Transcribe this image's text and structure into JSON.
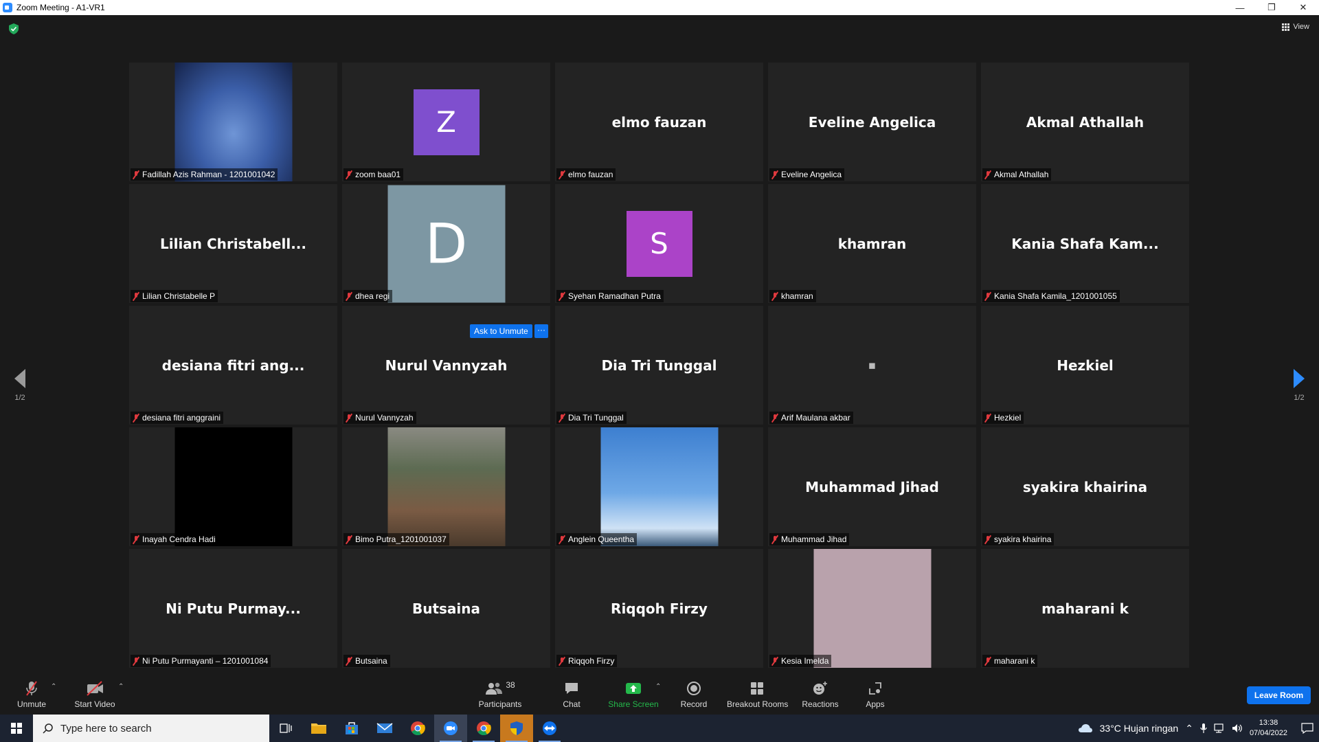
{
  "window": {
    "title": "Zoom Meeting - A1-VR1",
    "minimize": "—",
    "restore": "❐",
    "close": "✕"
  },
  "meeting": {
    "view_label": "View",
    "ask_to_unmute": "Ask to Unmute",
    "more": "···",
    "pager_left": "1/2",
    "pager_right": "1/2"
  },
  "tiles": [
    {
      "display": "",
      "label": "Fadillah Azis Rahman - 1201001042",
      "kind": "video",
      "bg": "#3b5ea8"
    },
    {
      "display": "Z",
      "label": "zoom baa01",
      "kind": "avatar",
      "color": "#7f4fce"
    },
    {
      "display": "elmo fauzan",
      "label": "elmo fauzan",
      "kind": "name"
    },
    {
      "display": "Eveline Angelica",
      "label": "Eveline Angelica",
      "kind": "name"
    },
    {
      "display": "Akmal Athallah",
      "label": "Akmal Athallah",
      "kind": "name"
    },
    {
      "display": "Lilian  Christabell...",
      "label": "Lilian Christabelle P",
      "kind": "name"
    },
    {
      "display": "D",
      "label": "dhea regi",
      "kind": "bigavatar",
      "color": "#7d97a3"
    },
    {
      "display": "S",
      "label": "Syehan Ramadhan Putra",
      "kind": "avatar",
      "color": "#ab43c8"
    },
    {
      "display": "khamran",
      "label": "khamran",
      "kind": "name"
    },
    {
      "display": "Kania  Shafa  Kam...",
      "label": "Kania Shafa Kamila_1201001055",
      "kind": "name"
    },
    {
      "display": "desiana fitri ang...",
      "label": "desiana fitri anggraini",
      "kind": "name"
    },
    {
      "display": "Nurul Vannyzah",
      "label": "Nurul Vannyzah",
      "kind": "name"
    },
    {
      "display": "Dia Tri Tunggal",
      "label": "Dia Tri Tunggal",
      "kind": "name"
    },
    {
      "display": "■",
      "label": "Arif Maulana akbar",
      "kind": "dot"
    },
    {
      "display": "Hezkiel",
      "label": "Hezkiel",
      "kind": "name"
    },
    {
      "display": "",
      "label": "Inayah Cendra Hadi",
      "kind": "video",
      "bg": "#000000"
    },
    {
      "display": "",
      "label": "Bimo Putra_1201001037",
      "kind": "video",
      "bg": "#5a4a3a"
    },
    {
      "display": "",
      "label": "Anglein Queentha",
      "kind": "video",
      "bg": "#4a8fd8"
    },
    {
      "display": "Muhammad Jihad",
      "label": "Muhammad Jihad",
      "kind": "name"
    },
    {
      "display": "syakira khairina",
      "label": "syakira khairina",
      "kind": "name"
    },
    {
      "display": "Ni Putu Purmay...",
      "label": "Ni Putu Purmayanti – 1201001084",
      "kind": "name"
    },
    {
      "display": "Butsaina",
      "label": "Butsaina",
      "kind": "name"
    },
    {
      "display": "Riqqoh Firzy",
      "label": "Riqqoh Firzy",
      "kind": "name"
    },
    {
      "display": "",
      "label": "Kesia Imelda",
      "kind": "video",
      "bg": "#b9a2ac"
    },
    {
      "display": "maharani k",
      "label": "maharani k",
      "kind": "name"
    }
  ],
  "toolbar": {
    "unmute": "Unmute",
    "start_video": "Start Video",
    "participants": "Participants",
    "participants_count": "38",
    "chat": "Chat",
    "share_screen": "Share Screen",
    "record": "Record",
    "breakout_rooms": "Breakout Rooms",
    "reactions": "Reactions",
    "apps": "Apps",
    "leave_room": "Leave Room"
  },
  "taskbar": {
    "search_placeholder": "Type here to search",
    "weather": "33°C  Hujan ringan",
    "time": "13:38",
    "date": "07/04/2022"
  },
  "colors": {
    "accent": "#0e72ed",
    "muted_red": "#e0393e",
    "share_green": "#24b94b"
  }
}
